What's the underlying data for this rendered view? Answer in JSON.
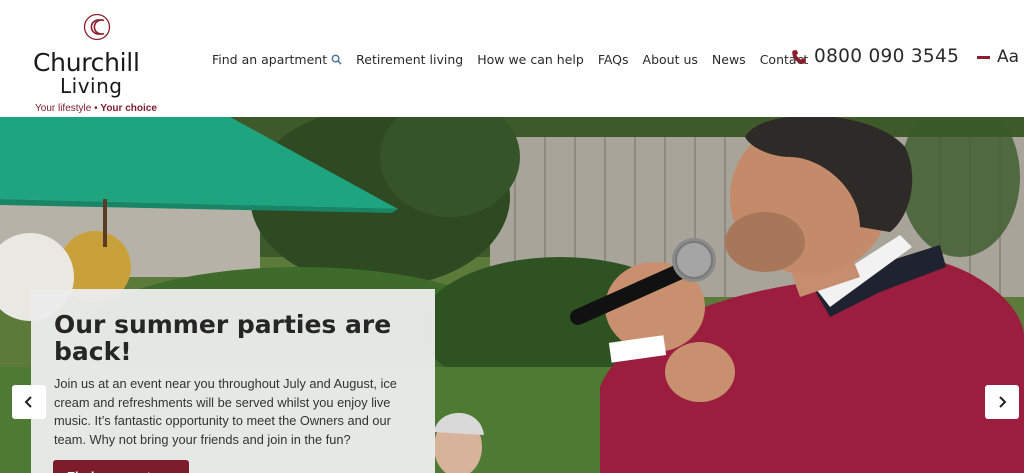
{
  "brand": {
    "name": "Churchill",
    "name_sub": "Living",
    "tagline_a": "Your lifestyle",
    "tagline_sep": " • ",
    "tagline_b": "Your choice",
    "accent_color": "#7d1d2c"
  },
  "nav": {
    "items": [
      {
        "label": "Find an apartment",
        "icon": "search-icon"
      },
      {
        "label": "Retirement living"
      },
      {
        "label": "How we can help"
      },
      {
        "label": "FAQs"
      },
      {
        "label": "About us"
      },
      {
        "label": "News"
      },
      {
        "label": "Contact"
      }
    ]
  },
  "contact": {
    "phone": "0800 090 3545",
    "phone_icon": "phone-icon"
  },
  "accessibility": {
    "text_size_label": "Aa"
  },
  "hero": {
    "title": "Our summer parties are back!",
    "body": "Join us at an event near you throughout July and August, ice cream and refreshments will be served whilst you enjoy live music. It’s fantastic opportunity to meet the Owners and our team. Why not bring your friends and join in the fun?",
    "button_label": "Find an event ›",
    "prev_icon": "chevron-left-icon",
    "next_icon": "chevron-right-icon"
  }
}
